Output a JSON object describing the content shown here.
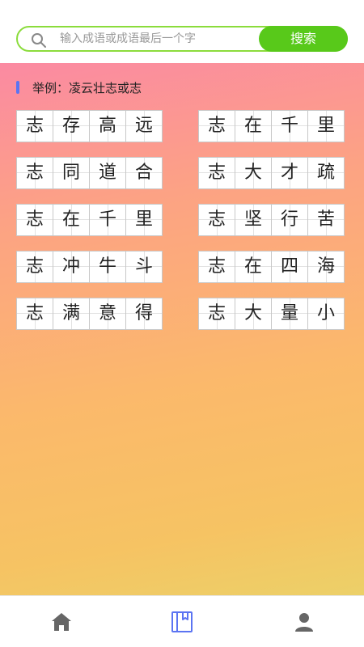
{
  "search": {
    "placeholder": "输入成语或成语最后一个字",
    "button_label": "搜索"
  },
  "example": {
    "text": "举例：凌云壮志或志"
  },
  "idioms_left": [
    [
      "志",
      "存",
      "高",
      "远"
    ],
    [
      "志",
      "同",
      "道",
      "合"
    ],
    [
      "志",
      "在",
      "千",
      "里"
    ],
    [
      "志",
      "冲",
      "牛",
      "斗"
    ],
    [
      "志",
      "满",
      "意",
      "得"
    ]
  ],
  "idioms_right": [
    [
      "志",
      "在",
      "千",
      "里"
    ],
    [
      "志",
      "大",
      "才",
      "疏"
    ],
    [
      "志",
      "坚",
      "行",
      "苦"
    ],
    [
      "志",
      "在",
      "四",
      "海"
    ],
    [
      "志",
      "大",
      "量",
      "小"
    ]
  ],
  "nav": {
    "items": [
      "home-icon",
      "book-icon",
      "user-icon"
    ],
    "active_color": "#5b74f2",
    "inactive_color": "#666666"
  },
  "colors": {
    "accent_green": "#58c91a",
    "marker_blue": "#5b74f2"
  }
}
